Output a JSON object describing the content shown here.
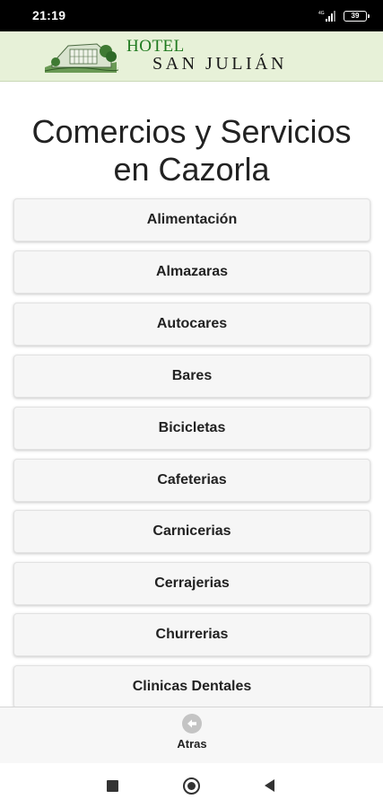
{
  "status_bar": {
    "time": "21:19",
    "battery_level": "39",
    "icons": [
      "signal-icon",
      "battery-icon"
    ]
  },
  "header": {
    "logo_top": "HOTEL",
    "logo_name": "SAN JULIÁN",
    "brand_color": "#1f7a1f",
    "background_color": "#e7f1d8"
  },
  "page": {
    "title_line1": "Comercios y Servicios",
    "title_line2": "en Cazorla"
  },
  "categories": [
    "Alimentación",
    "Almazaras",
    "Autocares",
    "Bares",
    "Bicicletas",
    "Cafeterias",
    "Carnicerias",
    "Cerrajerias",
    "Churrerias",
    "Clinicas Dentales"
  ],
  "bottom_nav": {
    "back_label": "Atras",
    "icon": "back-arrow-icon"
  },
  "system_nav": {
    "icons": [
      "recent-apps-icon",
      "home-icon",
      "back-icon"
    ]
  }
}
